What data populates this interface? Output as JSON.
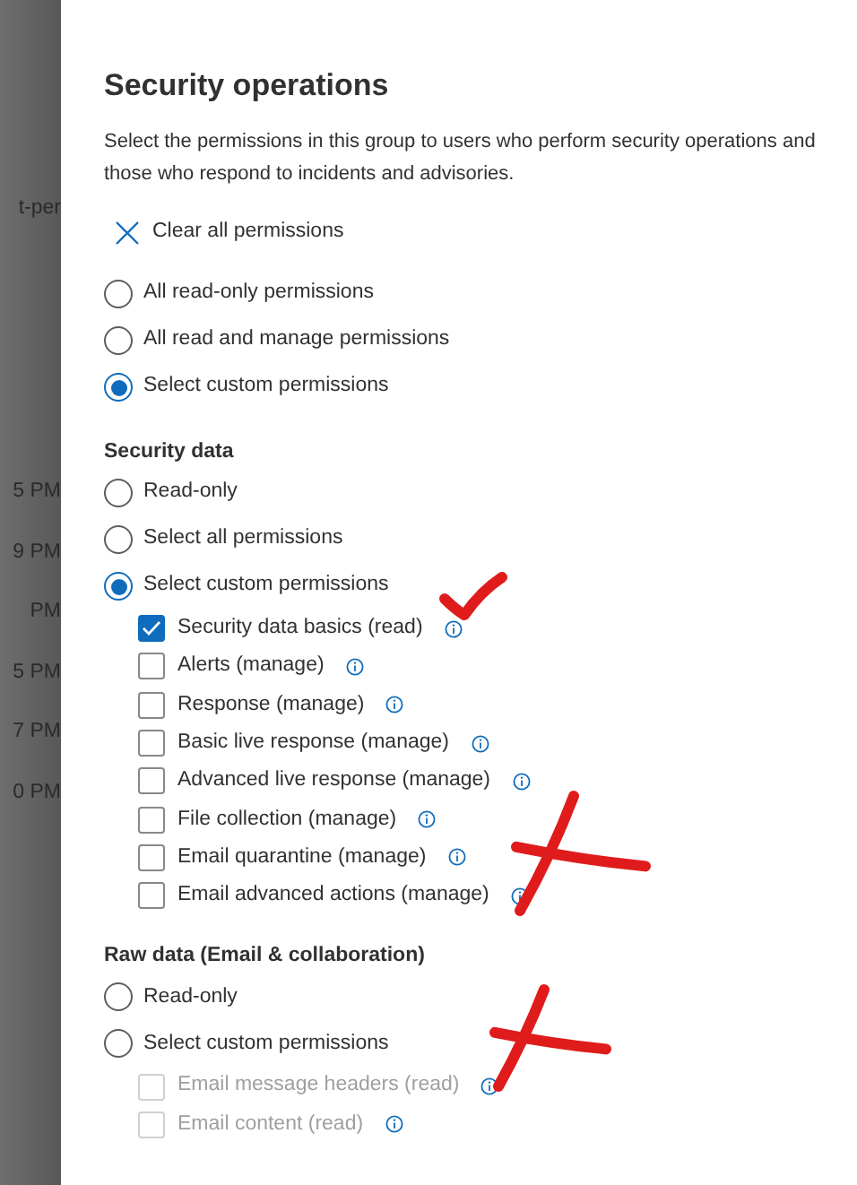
{
  "background": {
    "items": [
      {
        "text": "t-per"
      },
      {
        "text": "5 PM"
      },
      {
        "text": "9 PM"
      },
      {
        "text": "PM"
      },
      {
        "text": "5 PM"
      },
      {
        "text": "7 PM"
      },
      {
        "text": "0 PM"
      }
    ]
  },
  "panel": {
    "title": "Security operations",
    "description": "Select the permissions in this group to users who perform security operations and those who respond to incidents and advisories.",
    "clear_action": {
      "label": "Clear all permissions"
    },
    "options": [
      {
        "label": "All read-only permissions",
        "selected": false
      },
      {
        "label": "All read and manage permissions",
        "selected": false
      },
      {
        "label": "Select custom permissions",
        "selected": true
      }
    ],
    "sections": [
      {
        "title": "Security data",
        "options": [
          {
            "label": "Read-only",
            "selected": false
          },
          {
            "label": "Select all permissions",
            "selected": false
          },
          {
            "label": "Select custom permissions",
            "selected": true
          }
        ],
        "permissions": [
          {
            "label": "Security data basics (read)",
            "checked": true,
            "disabled": false
          },
          {
            "label": "Alerts (manage)",
            "checked": false,
            "disabled": false
          },
          {
            "label": "Response (manage)",
            "checked": false,
            "disabled": false
          },
          {
            "label": "Basic live response (manage)",
            "checked": false,
            "disabled": false
          },
          {
            "label": "Advanced live response (manage)",
            "checked": false,
            "disabled": false
          },
          {
            "label": "File collection (manage)",
            "checked": false,
            "disabled": false
          },
          {
            "label": "Email quarantine (manage)",
            "checked": false,
            "disabled": false
          },
          {
            "label": "Email advanced actions (manage)",
            "checked": false,
            "disabled": false
          }
        ]
      },
      {
        "title": "Raw data (Email & collaboration)",
        "options": [
          {
            "label": "Read-only",
            "selected": false
          },
          {
            "label": "Select custom permissions",
            "selected": false
          }
        ],
        "permissions": [
          {
            "label": "Email message headers (read)",
            "checked": false,
            "disabled": true
          },
          {
            "label": "Email content (read)",
            "checked": false,
            "disabled": true
          }
        ]
      }
    ]
  },
  "annotations": [
    {
      "kind": "check"
    },
    {
      "kind": "cross"
    },
    {
      "kind": "cross"
    }
  ]
}
